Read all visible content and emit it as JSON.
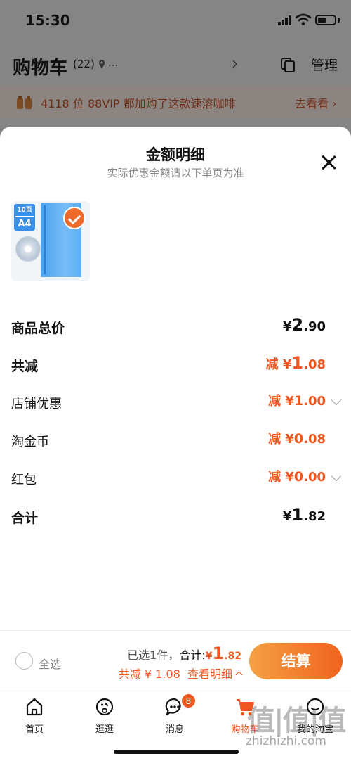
{
  "status_bar": {
    "time": "15:30"
  },
  "header": {
    "title": "购物车",
    "count": "(22)",
    "location": "...",
    "manage_label": "管理"
  },
  "promo": {
    "text": "4118 位 88VIP 都加购了这款速溶咖啡",
    "link": "去看看"
  },
  "modal": {
    "title": "金额明细",
    "subtitle": "实际优惠金额请以下单页为准",
    "product_badge_top": "10页",
    "product_badge_bottom": "A4",
    "rows": {
      "subtotal": {
        "label": "商品总价",
        "currency": "¥",
        "main": "2",
        "cents": ".90"
      },
      "total_reduction": {
        "label": "共减",
        "prefix": "减 ¥",
        "main": "1",
        "cents": ".08"
      },
      "store_discount": {
        "label": "店铺优惠",
        "prefix": "减 ¥",
        "main": "1",
        "cents": ".00"
      },
      "taobao_coins": {
        "label": "淘金币",
        "prefix": "减 ¥",
        "main": "0",
        "cents": ".08"
      },
      "red_packet": {
        "label": "红包",
        "prefix": "减 ¥",
        "main": "0",
        "cents": ".00"
      },
      "total": {
        "label": "合计",
        "currency": "¥",
        "main": "1",
        "cents": ".82"
      }
    }
  },
  "checkout": {
    "select_all_label": "全选",
    "selected_text": "已选1件，",
    "total_label": "合计:",
    "total_currency": "¥",
    "total_main": "1",
    "total_cents": ".82",
    "discount_text": "共减 ¥ 1.08",
    "view_detail": "查看明细",
    "checkout_label": "结算"
  },
  "tabs": [
    {
      "label": "首页"
    },
    {
      "label": "逛逛"
    },
    {
      "label": "消息",
      "badge": "8"
    },
    {
      "label": "购物车"
    },
    {
      "label": "我的淘宝"
    }
  ],
  "watermark": {
    "text": "值|值|值",
    "url": "zhizhizhi.com"
  },
  "colors": {
    "accent": "#f0561f",
    "checkout_gradient_start": "#f5a043",
    "checkout_gradient_end": "#f0631e"
  }
}
